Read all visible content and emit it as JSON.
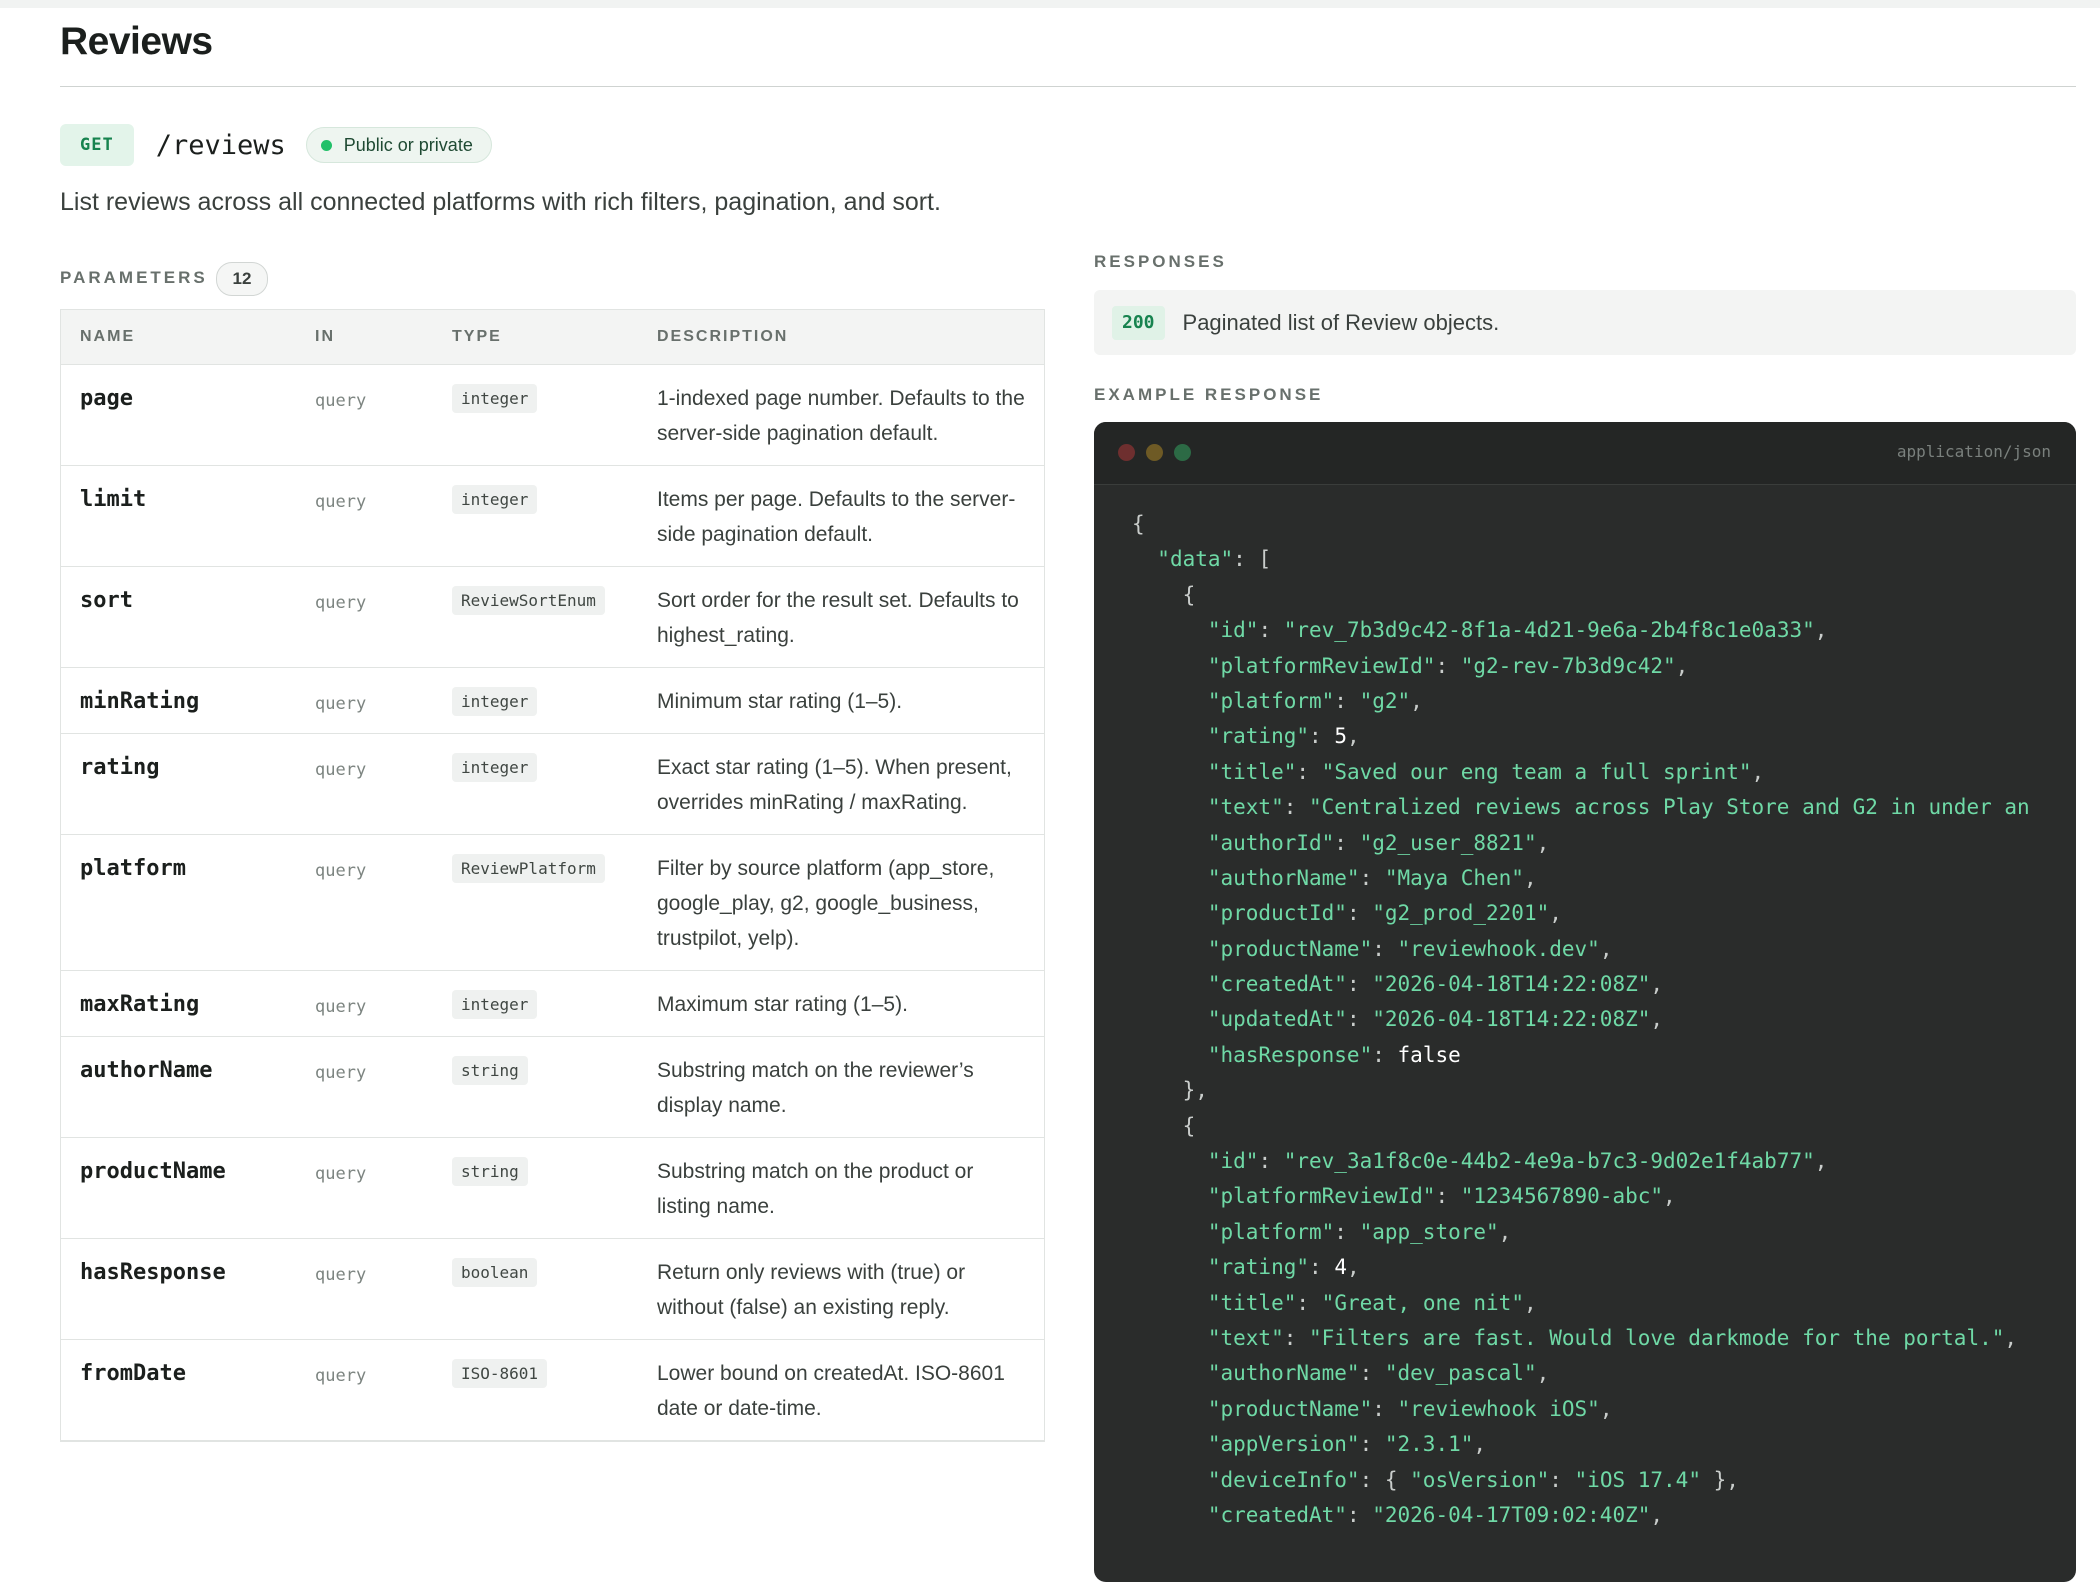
{
  "page": {
    "title": "Reviews"
  },
  "endpoint": {
    "method": "GET",
    "path": "/reviews",
    "visibility": "Public or private",
    "description": "List reviews across all connected platforms with rich filters, pagination, and sort."
  },
  "parameters": {
    "label": "PARAMETERS",
    "count": "12",
    "columns": [
      "NAME",
      "IN",
      "TYPE",
      "DESCRIPTION"
    ],
    "rows": [
      {
        "name": "page",
        "in": "query",
        "type": "integer",
        "description": "1-indexed page number. Defaults to the server-side pagination default."
      },
      {
        "name": "limit",
        "in": "query",
        "type": "integer",
        "description": "Items per page. Defaults to the server-side pagination default."
      },
      {
        "name": "sort",
        "in": "query",
        "type": "ReviewSortEnum",
        "description": "Sort order for the result set. Defaults to highest_rating."
      },
      {
        "name": "minRating",
        "in": "query",
        "type": "integer",
        "description": "Minimum star rating (1–5)."
      },
      {
        "name": "rating",
        "in": "query",
        "type": "integer",
        "description": "Exact star rating (1–5). When present, overrides minRating / maxRating."
      },
      {
        "name": "platform",
        "in": "query",
        "type": "ReviewPlatform",
        "description": "Filter by source platform (app_store, google_play, g2, google_business, trustpilot, yelp)."
      },
      {
        "name": "maxRating",
        "in": "query",
        "type": "integer",
        "description": "Maximum star rating (1–5)."
      },
      {
        "name": "authorName",
        "in": "query",
        "type": "string",
        "description": "Substring match on the reviewer’s display name."
      },
      {
        "name": "productName",
        "in": "query",
        "type": "string",
        "description": "Substring match on the product or listing name."
      },
      {
        "name": "hasResponse",
        "in": "query",
        "type": "boolean",
        "description": "Return only reviews with (true) or without (false) an existing reply."
      },
      {
        "name": "fromDate",
        "in": "query",
        "type": "ISO-8601",
        "description": "Lower bound on createdAt. ISO-8601 date or date-time."
      }
    ]
  },
  "responses": {
    "label": "RESPONSES",
    "items": [
      {
        "code": "200",
        "text": "Paginated list of Review objects."
      }
    ]
  },
  "example": {
    "label": "EXAMPLE RESPONSE",
    "content_type": "application/json",
    "lines": [
      [
        {
          "t": "{",
          "c": "p"
        }
      ],
      [
        {
          "t": "  "
        },
        {
          "t": "\"data\"",
          "c": "k"
        },
        {
          "t": ": [",
          "c": "p"
        }
      ],
      [
        {
          "t": "    {",
          "c": "p"
        }
      ],
      [
        {
          "t": "      "
        },
        {
          "t": "\"id\"",
          "c": "k"
        },
        {
          "t": ": ",
          "c": "p"
        },
        {
          "t": "\"rev_7b3d9c42-8f1a-4d21-9e6a-2b4f8c1e0a33\"",
          "c": "s"
        },
        {
          "t": ",",
          "c": "p"
        }
      ],
      [
        {
          "t": "      "
        },
        {
          "t": "\"platformReviewId\"",
          "c": "k"
        },
        {
          "t": ": ",
          "c": "p"
        },
        {
          "t": "\"g2-rev-7b3d9c42\"",
          "c": "s"
        },
        {
          "t": ",",
          "c": "p"
        }
      ],
      [
        {
          "t": "      "
        },
        {
          "t": "\"platform\"",
          "c": "k"
        },
        {
          "t": ": ",
          "c": "p"
        },
        {
          "t": "\"g2\"",
          "c": "s"
        },
        {
          "t": ",",
          "c": "p"
        }
      ],
      [
        {
          "t": "      "
        },
        {
          "t": "\"rating\"",
          "c": "k"
        },
        {
          "t": ": ",
          "c": "p"
        },
        {
          "t": "5",
          "c": "l"
        },
        {
          "t": ",",
          "c": "p"
        }
      ],
      [
        {
          "t": "      "
        },
        {
          "t": "\"title\"",
          "c": "k"
        },
        {
          "t": ": ",
          "c": "p"
        },
        {
          "t": "\"Saved our eng team a full sprint\"",
          "c": "s"
        },
        {
          "t": ",",
          "c": "p"
        }
      ],
      [
        {
          "t": "      "
        },
        {
          "t": "\"text\"",
          "c": "k"
        },
        {
          "t": ": ",
          "c": "p"
        },
        {
          "t": "\"Centralized reviews across Play Store and G2 in under an",
          "c": "s"
        }
      ],
      [
        {
          "t": "      "
        },
        {
          "t": "\"authorId\"",
          "c": "k"
        },
        {
          "t": ": ",
          "c": "p"
        },
        {
          "t": "\"g2_user_8821\"",
          "c": "s"
        },
        {
          "t": ",",
          "c": "p"
        }
      ],
      [
        {
          "t": "      "
        },
        {
          "t": "\"authorName\"",
          "c": "k"
        },
        {
          "t": ": ",
          "c": "p"
        },
        {
          "t": "\"Maya Chen\"",
          "c": "s"
        },
        {
          "t": ",",
          "c": "p"
        }
      ],
      [
        {
          "t": "      "
        },
        {
          "t": "\"productId\"",
          "c": "k"
        },
        {
          "t": ": ",
          "c": "p"
        },
        {
          "t": "\"g2_prod_2201\"",
          "c": "s"
        },
        {
          "t": ",",
          "c": "p"
        }
      ],
      [
        {
          "t": "      "
        },
        {
          "t": "\"productName\"",
          "c": "k"
        },
        {
          "t": ": ",
          "c": "p"
        },
        {
          "t": "\"reviewhook.dev\"",
          "c": "s"
        },
        {
          "t": ",",
          "c": "p"
        }
      ],
      [
        {
          "t": "      "
        },
        {
          "t": "\"createdAt\"",
          "c": "k"
        },
        {
          "t": ": ",
          "c": "p"
        },
        {
          "t": "\"2026-04-18T14:22:08Z\"",
          "c": "s"
        },
        {
          "t": ",",
          "c": "p"
        }
      ],
      [
        {
          "t": "      "
        },
        {
          "t": "\"updatedAt\"",
          "c": "k"
        },
        {
          "t": ": ",
          "c": "p"
        },
        {
          "t": "\"2026-04-18T14:22:08Z\"",
          "c": "s"
        },
        {
          "t": ",",
          "c": "p"
        }
      ],
      [
        {
          "t": "      "
        },
        {
          "t": "\"hasResponse\"",
          "c": "k"
        },
        {
          "t": ": ",
          "c": "p"
        },
        {
          "t": "false",
          "c": "l"
        }
      ],
      [
        {
          "t": "    },",
          "c": "p"
        }
      ],
      [
        {
          "t": "    {",
          "c": "p"
        }
      ],
      [
        {
          "t": "      "
        },
        {
          "t": "\"id\"",
          "c": "k"
        },
        {
          "t": ": ",
          "c": "p"
        },
        {
          "t": "\"rev_3a1f8c0e-44b2-4e9a-b7c3-9d02e1f4ab77\"",
          "c": "s"
        },
        {
          "t": ",",
          "c": "p"
        }
      ],
      [
        {
          "t": "      "
        },
        {
          "t": "\"platformReviewId\"",
          "c": "k"
        },
        {
          "t": ": ",
          "c": "p"
        },
        {
          "t": "\"1234567890-abc\"",
          "c": "s"
        },
        {
          "t": ",",
          "c": "p"
        }
      ],
      [
        {
          "t": "      "
        },
        {
          "t": "\"platform\"",
          "c": "k"
        },
        {
          "t": ": ",
          "c": "p"
        },
        {
          "t": "\"app_store\"",
          "c": "s"
        },
        {
          "t": ",",
          "c": "p"
        }
      ],
      [
        {
          "t": "      "
        },
        {
          "t": "\"rating\"",
          "c": "k"
        },
        {
          "t": ": ",
          "c": "p"
        },
        {
          "t": "4",
          "c": "l"
        },
        {
          "t": ",",
          "c": "p"
        }
      ],
      [
        {
          "t": "      "
        },
        {
          "t": "\"title\"",
          "c": "k"
        },
        {
          "t": ": ",
          "c": "p"
        },
        {
          "t": "\"Great, one nit\"",
          "c": "s"
        },
        {
          "t": ",",
          "c": "p"
        }
      ],
      [
        {
          "t": "      "
        },
        {
          "t": "\"text\"",
          "c": "k"
        },
        {
          "t": ": ",
          "c": "p"
        },
        {
          "t": "\"Filters are fast. Would love darkmode for the portal.\"",
          "c": "s"
        },
        {
          "t": ",",
          "c": "p"
        }
      ],
      [
        {
          "t": "      "
        },
        {
          "t": "\"authorName\"",
          "c": "k"
        },
        {
          "t": ": ",
          "c": "p"
        },
        {
          "t": "\"dev_pascal\"",
          "c": "s"
        },
        {
          "t": ",",
          "c": "p"
        }
      ],
      [
        {
          "t": "      "
        },
        {
          "t": "\"productName\"",
          "c": "k"
        },
        {
          "t": ": ",
          "c": "p"
        },
        {
          "t": "\"reviewhook iOS\"",
          "c": "s"
        },
        {
          "t": ",",
          "c": "p"
        }
      ],
      [
        {
          "t": "      "
        },
        {
          "t": "\"appVersion\"",
          "c": "k"
        },
        {
          "t": ": ",
          "c": "p"
        },
        {
          "t": "\"2.3.1\"",
          "c": "s"
        },
        {
          "t": ",",
          "c": "p"
        }
      ],
      [
        {
          "t": "      "
        },
        {
          "t": "\"deviceInfo\"",
          "c": "k"
        },
        {
          "t": ": { ",
          "c": "p"
        },
        {
          "t": "\"osVersion\"",
          "c": "k"
        },
        {
          "t": ": ",
          "c": "p"
        },
        {
          "t": "\"iOS 17.4\"",
          "c": "s"
        },
        {
          "t": " },",
          "c": "p"
        }
      ],
      [
        {
          "t": "      "
        },
        {
          "t": "\"createdAt\"",
          "c": "k"
        },
        {
          "t": ": ",
          "c": "p"
        },
        {
          "t": "\"2026-04-17T09:02:40Z\"",
          "c": "s"
        },
        {
          "t": ",",
          "c": "p"
        }
      ]
    ]
  },
  "colors": {
    "accent_green": "#17834f",
    "status_dot": "#22c069",
    "code_background": "#2a2c2b",
    "code_key": "#6fd9a6"
  },
  "icons": {
    "status": "status-dot-icon",
    "window_controls": [
      "window-close-icon",
      "window-minimize-icon",
      "window-maximize-icon"
    ]
  }
}
